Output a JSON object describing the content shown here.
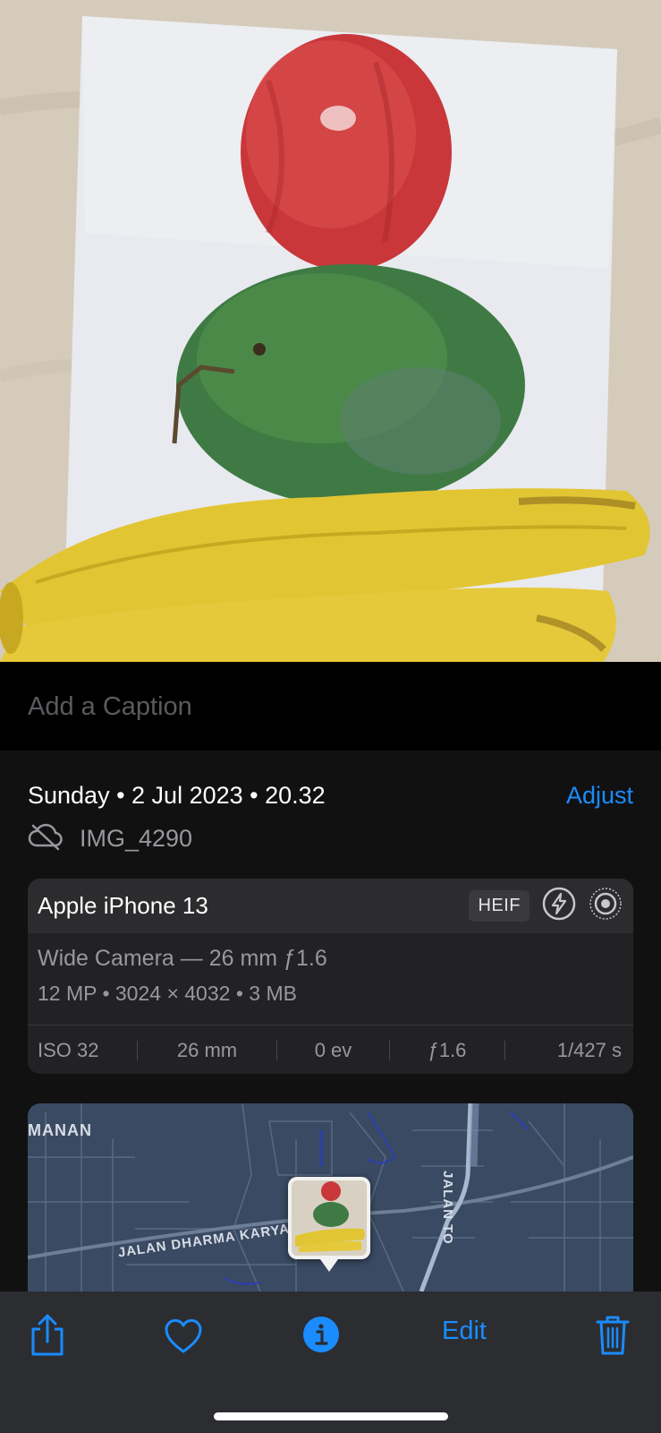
{
  "caption": {
    "placeholder": "Add a Caption"
  },
  "info": {
    "date": "Sunday • 2 Jul 2023 • 20.32",
    "adjust_label": "Adjust",
    "file_name": "IMG_4290"
  },
  "camera": {
    "model": "Apple iPhone 13",
    "format_badge": "HEIF",
    "lens": "Wide Camera — 26 mm ƒ1.6",
    "specs": "12 MP  •  3024 × 4032  •  3 MB",
    "exif": {
      "iso": "ISO 32",
      "focal": "26 mm",
      "ev": "0 ev",
      "aperture": "ƒ1.6",
      "shutter": "1/427 s"
    }
  },
  "map": {
    "labels": {
      "area": "MANAN",
      "street_a": "JALAN DHARMA KARYA",
      "street_b": "JALAN TO"
    }
  },
  "toolbar": {
    "edit_label": "Edit"
  },
  "icons": {
    "cloud_off": "cloud-slash-icon",
    "flash": "flash-icon",
    "live": "live-photo-icon",
    "share": "share-icon",
    "favorite": "heart-icon",
    "info": "info-icon",
    "delete": "trash-icon"
  },
  "colors": {
    "accent": "#1a8cff",
    "background": "#111112",
    "toolbar": "#2b2d31"
  }
}
